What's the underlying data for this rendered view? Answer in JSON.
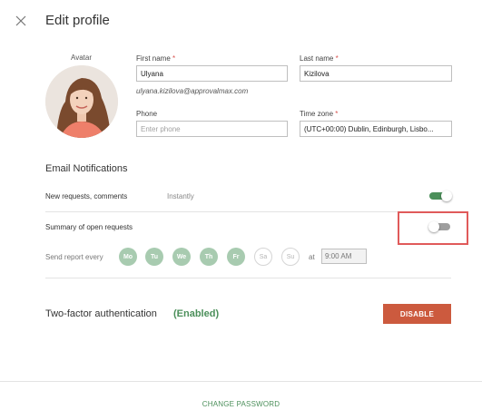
{
  "header": {
    "title": "Edit profile",
    "close_icon": "close-icon"
  },
  "avatar": {
    "label": "Avatar"
  },
  "profile": {
    "first_name_label": "First name",
    "first_name_value": "Ulyana",
    "last_name_label": "Last name",
    "last_name_value": "Kizilova",
    "required_mark": "*",
    "email": "ulyana.kizilova@approvalmax.com",
    "phone_label": "Phone",
    "phone_placeholder": "Enter phone",
    "timezone_label": "Time zone",
    "timezone_value": "(UTC+00:00) Dublin, Edinburgh, Lisbo..."
  },
  "notifications": {
    "title": "Email Notifications",
    "new_requests_label": "New requests, comments",
    "new_requests_frequency": "Instantly",
    "new_requests_enabled": true,
    "summary_label": "Summary of open requests",
    "summary_enabled": false,
    "send_report_label": "Send report every",
    "days": [
      {
        "label": "Mo",
        "selected": true
      },
      {
        "label": "Tu",
        "selected": true
      },
      {
        "label": "We",
        "selected": true
      },
      {
        "label": "Th",
        "selected": true
      },
      {
        "label": "Fr",
        "selected": true
      },
      {
        "label": "Sa",
        "selected": false
      },
      {
        "label": "Su",
        "selected": false
      }
    ],
    "at_label": "at",
    "time_value": "9:00 AM"
  },
  "two_factor": {
    "label": "Two-factor authentication",
    "status": "(Enabled)",
    "disable_button": "DISABLE"
  },
  "footer": {
    "change_password": "CHANGE PASSWORD"
  },
  "colors": {
    "accent_green": "#4b8f5a",
    "day_selected": "#a8cbb0",
    "disable_button": "#cc5a3e",
    "highlight_border": "#e05a5a",
    "required": "#d9534f"
  }
}
